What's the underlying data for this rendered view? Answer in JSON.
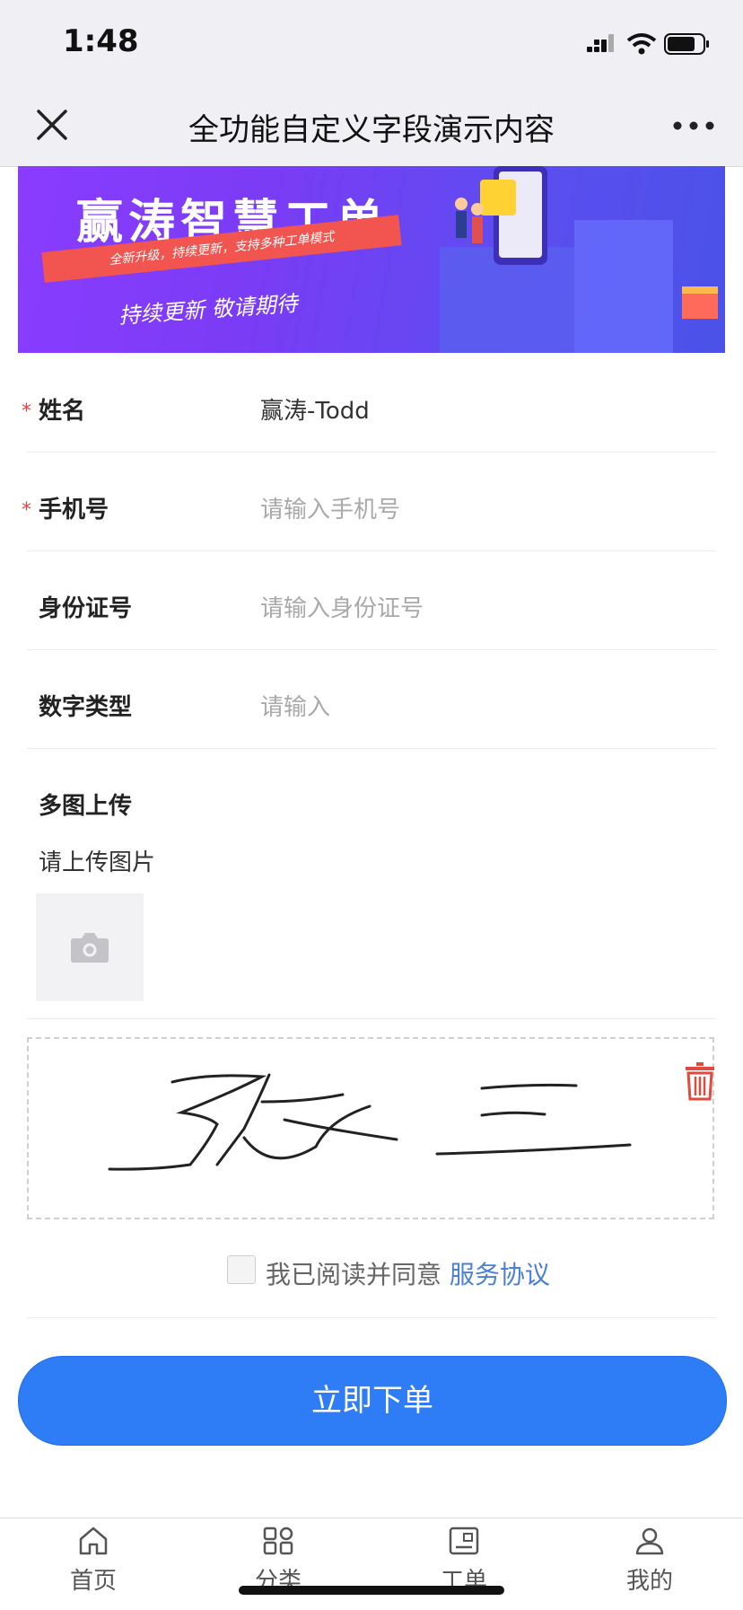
{
  "status": {
    "time": "1:48"
  },
  "nav": {
    "title": "全功能自定义字段演示内容"
  },
  "banner": {
    "title": "赢涛智慧工单",
    "ribbon": "全新升级，持续更新，支持多种工单模式",
    "subtitle": "持续更新  敬请期待"
  },
  "form": {
    "name": {
      "label": "姓名",
      "value": "赢涛-Todd",
      "required_mark": "*"
    },
    "phone": {
      "label": "手机号",
      "placeholder": "请输入手机号",
      "required_mark": "*"
    },
    "idcard": {
      "label": "身份证号",
      "placeholder": "请输入身份证号"
    },
    "number": {
      "label": "数字类型",
      "placeholder": "请输入"
    },
    "upload": {
      "label": "多图上传",
      "hint": "请上传图片"
    }
  },
  "signature": {
    "text": "张三"
  },
  "agreement": {
    "text": "我已阅读并同意",
    "link": "服务协议",
    "checked": false
  },
  "submit": {
    "label": "立即下单"
  },
  "tabbar": {
    "items": [
      {
        "label": "首页",
        "icon": "home-icon"
      },
      {
        "label": "分类",
        "icon": "grid-icon"
      },
      {
        "label": "工单",
        "icon": "ticket-icon"
      },
      {
        "label": "我的",
        "icon": "user-icon"
      }
    ]
  },
  "colors": {
    "accent": "#2e7cf6",
    "link": "#4a7fd6",
    "required": "#e64340",
    "trash": "#e04a3f"
  }
}
